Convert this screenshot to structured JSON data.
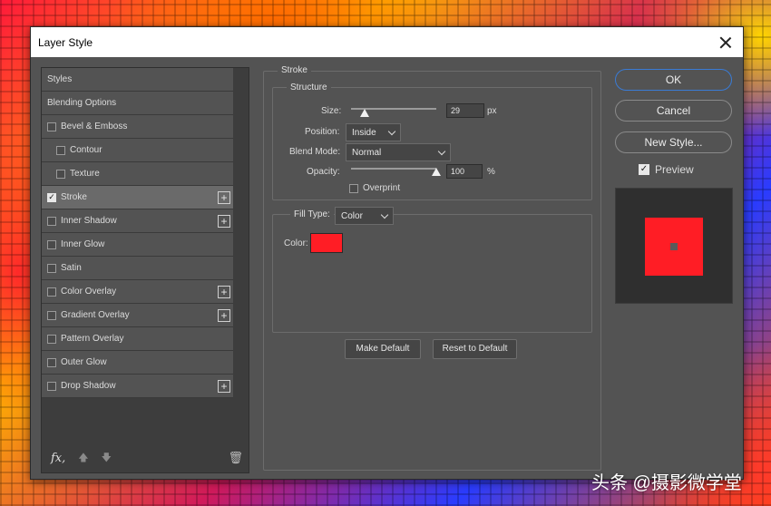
{
  "window": {
    "title": "Layer Style"
  },
  "styles_list": {
    "items": [
      {
        "label": "Styles",
        "checkbox": false,
        "checked": false,
        "plus": false,
        "indent": 0,
        "selected": false
      },
      {
        "label": "Blending Options",
        "checkbox": false,
        "checked": false,
        "plus": false,
        "indent": 0,
        "selected": false
      },
      {
        "label": "Bevel & Emboss",
        "checkbox": true,
        "checked": false,
        "plus": false,
        "indent": 0,
        "selected": false
      },
      {
        "label": "Contour",
        "checkbox": true,
        "checked": false,
        "plus": false,
        "indent": 1,
        "selected": false
      },
      {
        "label": "Texture",
        "checkbox": true,
        "checked": false,
        "plus": false,
        "indent": 1,
        "selected": false
      },
      {
        "label": "Stroke",
        "checkbox": true,
        "checked": true,
        "plus": true,
        "indent": 0,
        "selected": true
      },
      {
        "label": "Inner Shadow",
        "checkbox": true,
        "checked": false,
        "plus": true,
        "indent": 0,
        "selected": false
      },
      {
        "label": "Inner Glow",
        "checkbox": true,
        "checked": false,
        "plus": false,
        "indent": 0,
        "selected": false
      },
      {
        "label": "Satin",
        "checkbox": true,
        "checked": false,
        "plus": false,
        "indent": 0,
        "selected": false
      },
      {
        "label": "Color Overlay",
        "checkbox": true,
        "checked": false,
        "plus": true,
        "indent": 0,
        "selected": false
      },
      {
        "label": "Gradient Overlay",
        "checkbox": true,
        "checked": false,
        "plus": true,
        "indent": 0,
        "selected": false
      },
      {
        "label": "Pattern Overlay",
        "checkbox": true,
        "checked": false,
        "plus": false,
        "indent": 0,
        "selected": false
      },
      {
        "label": "Outer Glow",
        "checkbox": true,
        "checked": false,
        "plus": false,
        "indent": 0,
        "selected": false
      },
      {
        "label": "Drop Shadow",
        "checkbox": true,
        "checked": false,
        "plus": true,
        "indent": 0,
        "selected": false
      }
    ],
    "footer": {
      "fx": "fx",
      "fx_sub": ","
    }
  },
  "stroke": {
    "title": "Stroke",
    "structure_title": "Structure",
    "size_label": "Size:",
    "size_value": "29",
    "size_unit": "px",
    "position_label": "Position:",
    "position_value": "Inside",
    "blend_mode_label": "Blend Mode:",
    "blend_mode_value": "Normal",
    "opacity_label": "Opacity:",
    "opacity_value": "100",
    "opacity_unit": "%",
    "overprint_label": "Overprint",
    "overprint_checked": false,
    "fill_type_label": "Fill Type:",
    "fill_type_value": "Color",
    "color_label": "Color:",
    "color_value": "#ff1d25",
    "make_default": "Make Default",
    "reset_to_default": "Reset to Default"
  },
  "actions": {
    "ok": "OK",
    "cancel": "Cancel",
    "new_style": "New Style...",
    "preview_label": "Preview",
    "preview_checked": true
  },
  "watermark": "头条 @摄影微学堂",
  "colors": {
    "dialog_bg": "#535353",
    "accent": "#3a7bd5",
    "stroke_color": "#ff1d25"
  }
}
